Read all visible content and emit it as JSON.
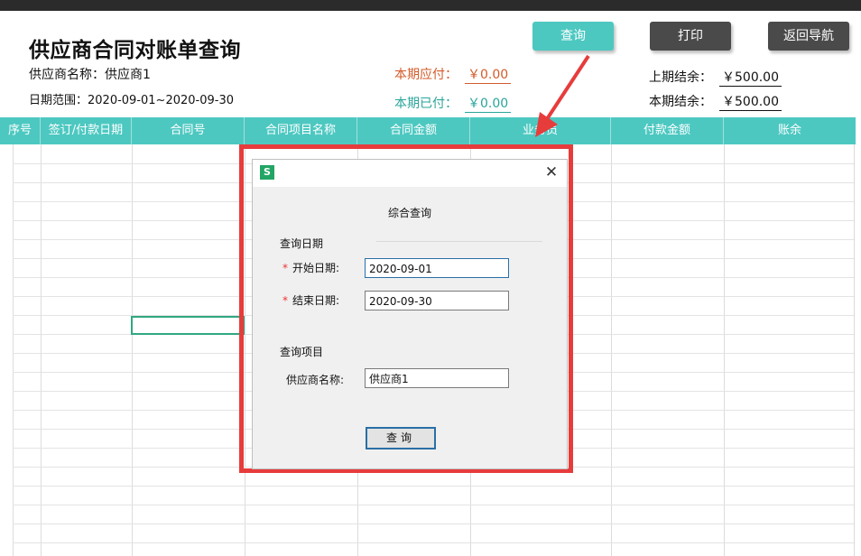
{
  "page": {
    "title": "供应商合同对账单查询",
    "supplier_line": "供应商名称：供应商1",
    "date_range_line": "日期范围：2020-09-01~2020-09-30"
  },
  "toolbar": {
    "query_label": "查询",
    "print_label": "打印",
    "back_label": "返回导航"
  },
  "summary": {
    "due_label": "本期应付：",
    "due_value": "￥0.00",
    "paid_label": "本期已付：",
    "paid_value": "￥0.00",
    "prev_balance_label": "上期结余：",
    "prev_balance_value": "￥500.00",
    "cur_balance_label": "本期结余：",
    "cur_balance_value": "￥500.00"
  },
  "table": {
    "columns": [
      "序号",
      "签订/付款日期",
      "合同号",
      "合同项目名称",
      "合同金额",
      "业务员",
      "付款金额",
      "账余"
    ]
  },
  "dialog": {
    "icon_text": "S",
    "heading": "综合查询",
    "date_section": "查询日期",
    "start_label": "开始日期:",
    "start_value": "2020-09-01",
    "end_label": "结束日期:",
    "end_value": "2020-09-30",
    "item_section": "查询项目",
    "supplier_label": "供应商名称:",
    "supplier_value": "供应商1",
    "submit_label": "查询",
    "required_mark": "*",
    "close_glyph": "✕"
  },
  "colors": {
    "accent": "#4dc8c1",
    "dark_button": "#4a4a4a",
    "due": "#d35b2a",
    "paid": "#2aa59a",
    "highlight": "#e73c3c"
  }
}
